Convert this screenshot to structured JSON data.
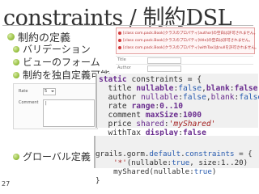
{
  "slide": {
    "title": "constraints / 制約DSL",
    "page_number": "27"
  },
  "bullets": {
    "top": "制約の定義",
    "sub": [
      "バリデーション",
      "ビューのフォーム",
      "制約を独自定義可能"
    ],
    "bottom": "グローバル定義"
  },
  "screenshot_errors": {
    "lines": [
      "[class com.pack.Book]クラスのプロパティ[author]の空白は許可されません。",
      "[class com.pack.Book]クラスのプロパティ[title]の空白は許可されません。",
      "[class com.pack.Book]クラスのプロパティ[withTax]はnullを許可されません。"
    ],
    "fields": [
      "Title",
      "Author"
    ]
  },
  "screenshot_form": {
    "rate_label": "Rate",
    "rate_value": "5",
    "comment_label": "Comment",
    "comment_value": "|"
  },
  "code1": {
    "line1": [
      "static ",
      "constraints",
      " = {"
    ],
    "line2": [
      "  title ",
      "nullable",
      ":",
      "false",
      ",",
      "blank",
      ":",
      "false"
    ],
    "line3": [
      "  author ",
      "nullable",
      ":",
      "false",
      ",",
      "blank",
      ":",
      "false"
    ],
    "line4": [
      "  rate ",
      "range",
      ":",
      "0..10"
    ],
    "line5": [
      "  comment ",
      "maxSize",
      ":",
      "1000"
    ],
    "line6": [
      "  price ",
      "shared",
      ":",
      "'myShared'"
    ],
    "line7": [
      "  withTax ",
      "display",
      ":",
      "false"
    ],
    "line8": "}"
  },
  "code2": {
    "line1": [
      "grails.gorm.",
      "default",
      ".",
      "constraints",
      " = {"
    ],
    "line2": [
      "    '*'",
      "(",
      "nullable",
      ":",
      "true",
      ", ",
      "size",
      ":",
      "1..20",
      ")"
    ],
    "line3": [
      "    myShared(",
      "nullable",
      ":",
      "true",
      ")"
    ],
    "line4": "}"
  }
}
